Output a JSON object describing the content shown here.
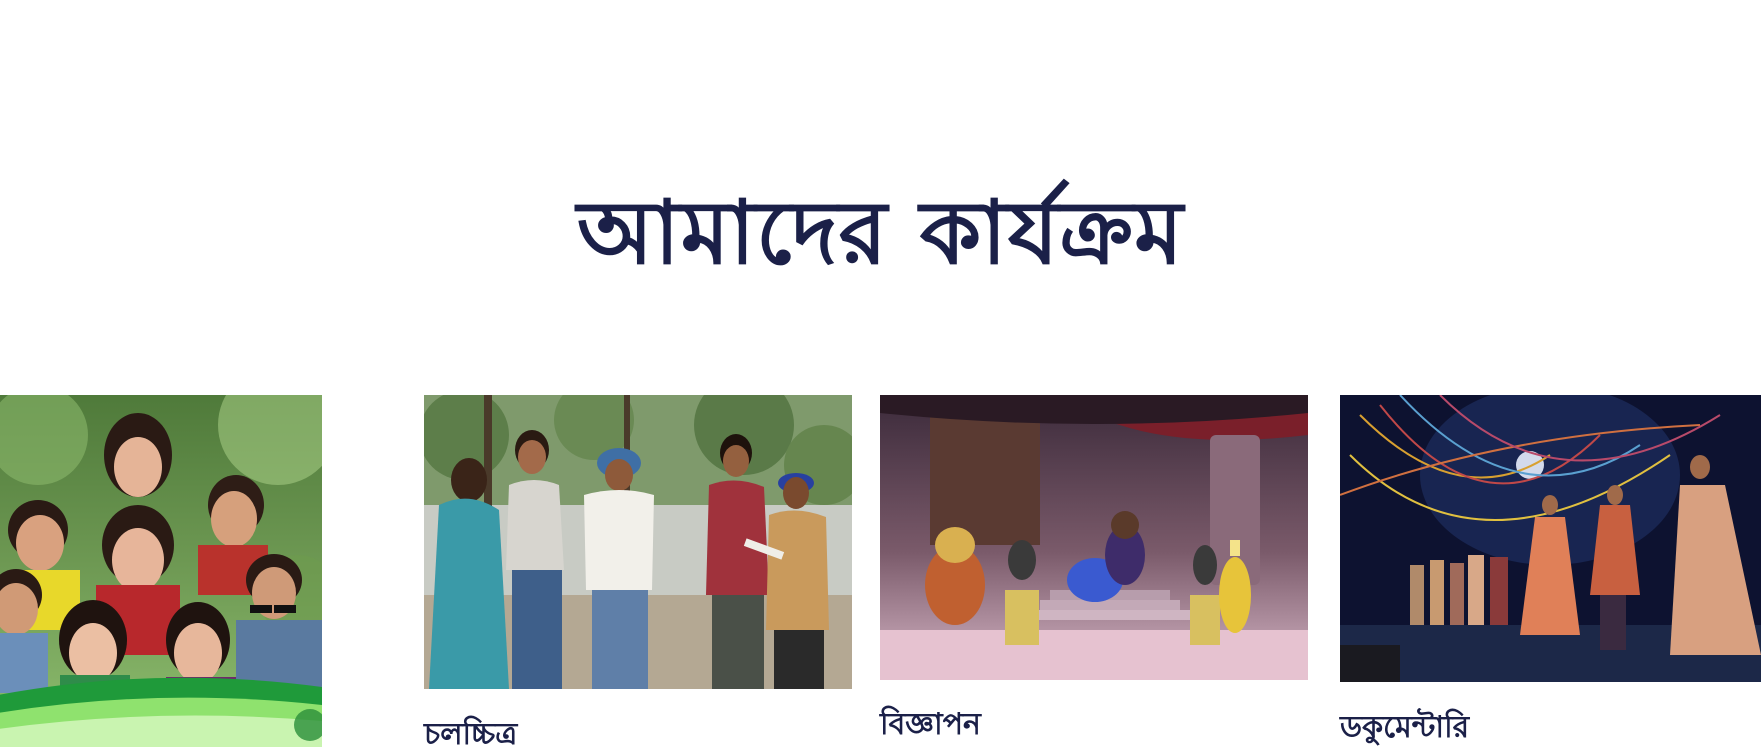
{
  "section": {
    "title": "আমাদের কার্যক্রম"
  },
  "cards": [
    {
      "label": "",
      "image_icon": "drama-cast-poster-image"
    },
    {
      "label": "চলচ্চিত্র",
      "image_icon": "film-shooting-scene-image"
    },
    {
      "label": "বিজ্ঞাপন",
      "image_icon": "stage-musical-scene-image"
    },
    {
      "label": "ডকুমেন্টারি",
      "image_icon": "theatre-performance-image"
    }
  ],
  "colors": {
    "heading": "#1b2048",
    "background": "#ffffff",
    "poster_green": "#1f9a3a"
  }
}
